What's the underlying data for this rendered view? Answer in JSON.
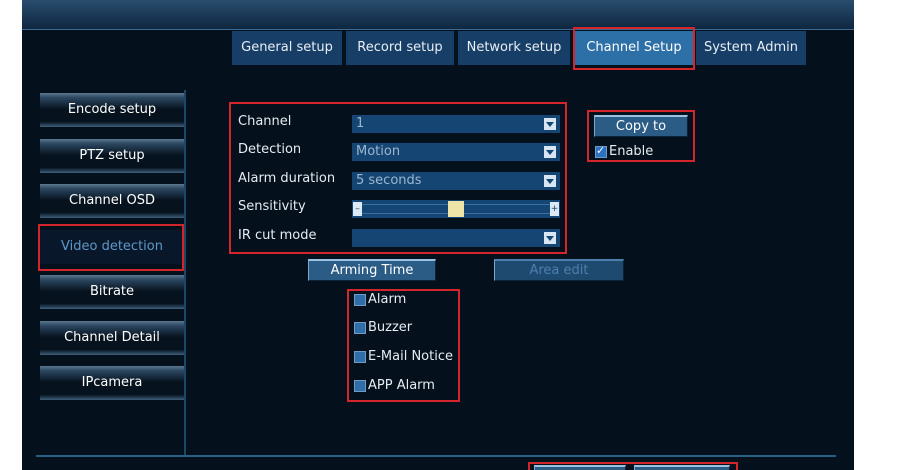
{
  "tabs": [
    "General setup",
    "Record setup",
    "Network setup",
    "Channel Setup",
    "System Admin"
  ],
  "active_tab": "Channel Setup",
  "sidebar": [
    "Encode setup",
    "PTZ setup",
    "Channel OSD",
    "Video detection",
    "Bitrate",
    "Channel Detail",
    "IPcamera"
  ],
  "active_sidebar": "Video detection",
  "form": {
    "channel_label": "Channel",
    "channel_value": "1",
    "detection_label": "Detection",
    "detection_value": "Motion",
    "alarm_duration_label": "Alarm duration",
    "alarm_duration_value": "5 seconds",
    "sensitivity_label": "Sensitivity",
    "sensitivity_value": 0.5,
    "ir_cut_label": "IR cut mode",
    "ir_cut_value": ""
  },
  "buttons": {
    "copy_to": "Copy to",
    "arming_time": "Arming Time",
    "area_edit": "Area edit"
  },
  "enable": {
    "label": "Enable",
    "checked": true
  },
  "options": [
    {
      "label": "Alarm",
      "checked": false
    },
    {
      "label": "Buzzer",
      "checked": false
    },
    {
      "label": "E-Mail Notice",
      "checked": false
    },
    {
      "label": "APP Alarm",
      "checked": false
    }
  ],
  "colors": {
    "background": "#04101c",
    "tab": "#173e66",
    "tab_active": "#2d6fa7",
    "highlight": "#d4252b",
    "slider_thumb": "#efe4a8"
  }
}
